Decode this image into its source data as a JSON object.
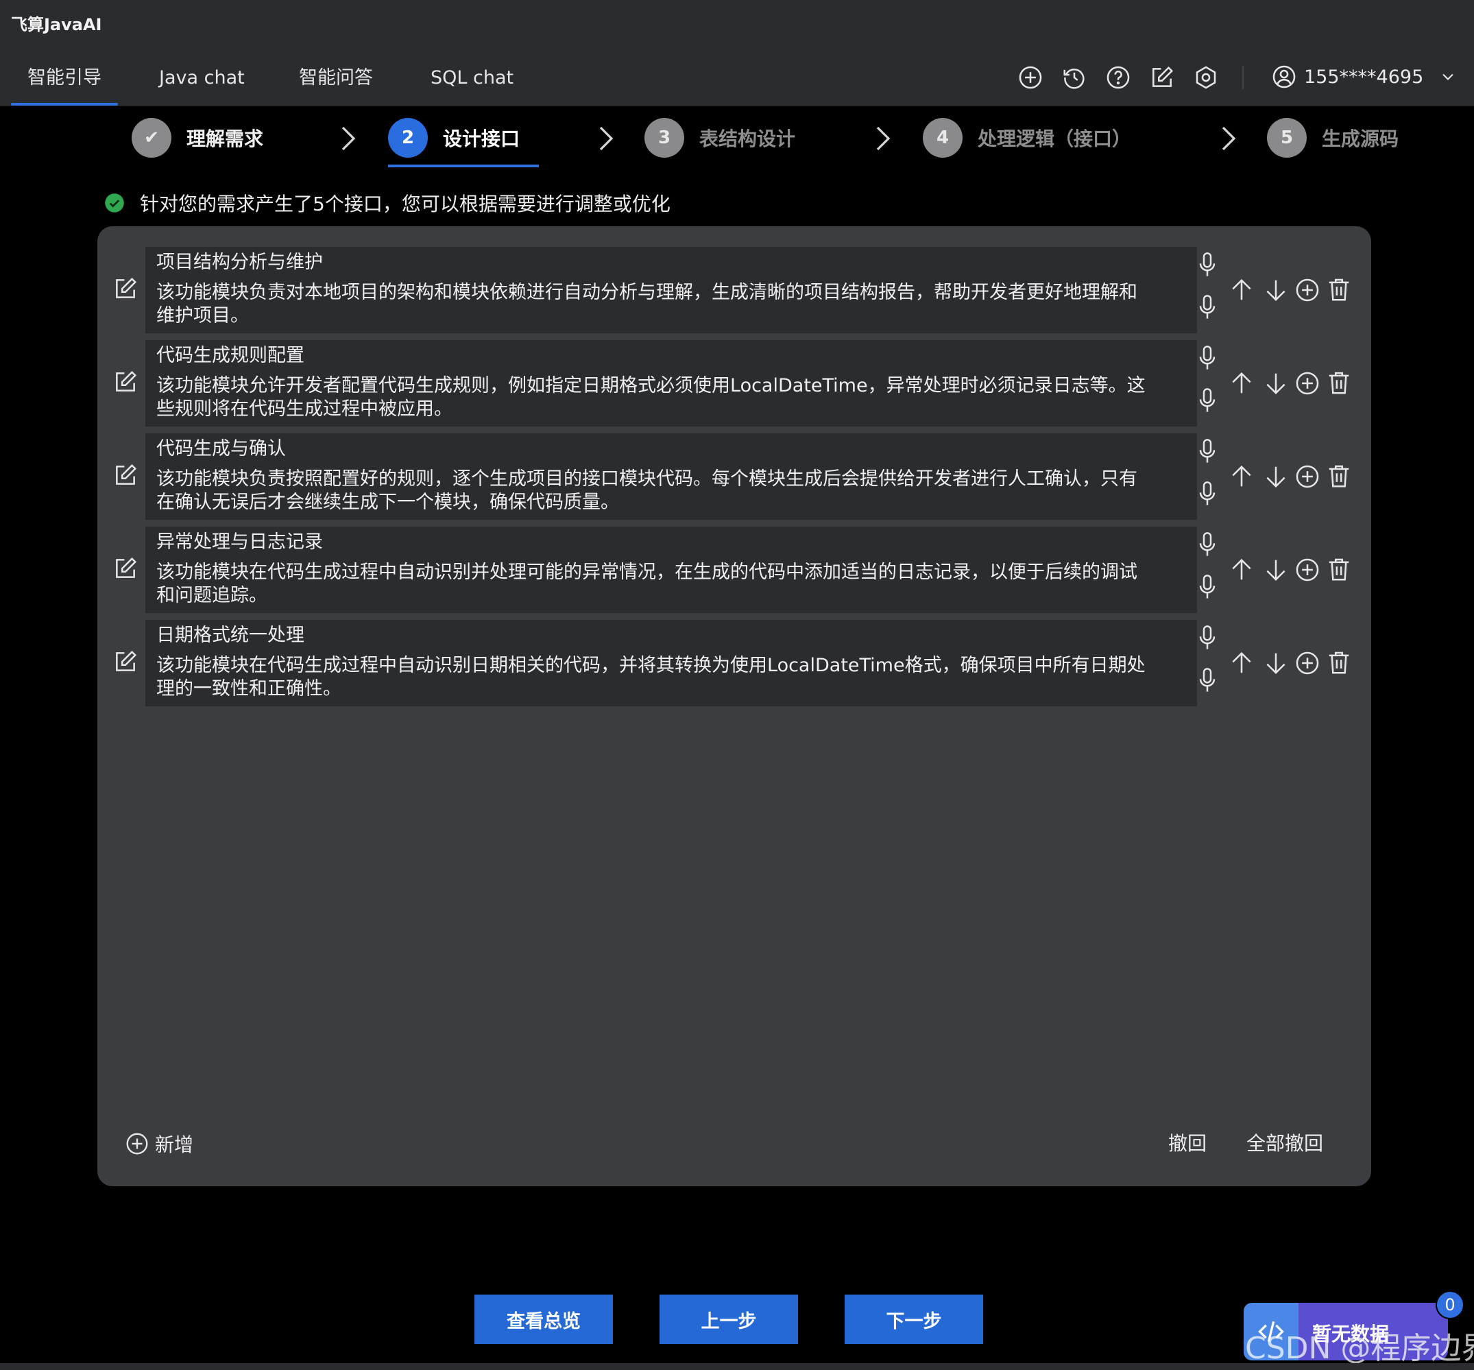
{
  "app": {
    "title": "飞算JavaAI"
  },
  "nav": {
    "tabs": [
      {
        "label": "智能引导",
        "active": true
      },
      {
        "label": "Java chat"
      },
      {
        "label": "智能问答"
      },
      {
        "label": "SQL chat"
      }
    ],
    "user": "155****4695"
  },
  "steps": [
    {
      "num": "✔",
      "label": "理解需求",
      "state": "done"
    },
    {
      "num": "2",
      "label": "设计接口",
      "state": "current"
    },
    {
      "num": "3",
      "label": "表结构设计",
      "state": "pending"
    },
    {
      "num": "4",
      "label": "处理逻辑（接口）",
      "state": "pending"
    },
    {
      "num": "5",
      "label": "生成源码",
      "state": "pending"
    }
  ],
  "notice": "针对您的需求产生了5个接口，您可以根据需要进行调整或优化",
  "items": [
    {
      "title": "项目结构分析与维护",
      "desc_line1": "该功能模块负责对本地项目的架构和模块依赖进行自动分析与理解，生成清晰的项目结构报告，帮助开发者更好地理解和",
      "desc_line2": "维护项目。"
    },
    {
      "title": "代码生成规则配置",
      "desc_line1": "该功能模块允许开发者配置代码生成规则，例如指定日期格式必须使用LocalDateTime，异常处理时必须记录日志等。这",
      "desc_line2": "些规则将在代码生成过程中被应用。"
    },
    {
      "title": "代码生成与确认",
      "desc_line1": "该功能模块负责按照配置好的规则，逐个生成项目的接口模块代码。每个模块生成后会提供给开发者进行人工确认，只有",
      "desc_line2": "在确认无误后才会继续生成下一个模块，确保代码质量。"
    },
    {
      "title": "异常处理与日志记录",
      "desc_line1": "该功能模块在代码生成过程中自动识别并处理可能的异常情况，在生成的代码中添加适当的日志记录，以便于后续的调试",
      "desc_line2": "和问题追踪。"
    },
    {
      "title": "日期格式统一处理",
      "desc_line1": "该功能模块在代码生成过程中自动识别日期相关的代码，并将其转换为使用LocalDateTime格式，确保项目中所有日期处",
      "desc_line2": "理的一致性和正确性。"
    }
  ],
  "panel": {
    "add_label": "新增",
    "undo_label": "撤回",
    "undo_all_label": "全部撤回"
  },
  "buttons": {
    "overview": "查看总览",
    "prev": "上一步",
    "next": "下一步"
  },
  "float": {
    "empty_label": "暂无数据",
    "badge": "0"
  },
  "watermark": "CSDN @程序边界",
  "icons": {
    "toolbar": [
      "plus-circle-icon",
      "history-icon",
      "help-icon",
      "edit-icon",
      "settings-icon"
    ],
    "row_actions": [
      "mic-icon",
      "arrow-up-icon",
      "arrow-down-icon",
      "plus-circle-icon",
      "trash-icon"
    ]
  },
  "colors": {
    "accent": "#2f6fe0",
    "button": "#2469d6",
    "panel": "#3c3d40",
    "card": "#2b2c2f",
    "success": "#2fa84f"
  }
}
